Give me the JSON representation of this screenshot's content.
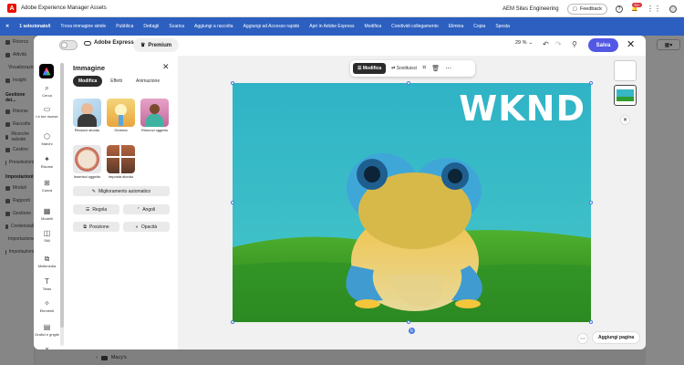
{
  "shell": {
    "app_name": "Adobe Experience Manager Assets",
    "org": "AEM Sites Engineering",
    "feedback": "Feedback",
    "notifications": "99+",
    "actions": [
      "1 selezionato/i",
      "Trova immagine simile",
      "Pubblica",
      "Dettagli",
      "Scarica",
      "Aggiungi a raccolta",
      "Aggiungi ad Accesso rapido",
      "Apri in Adobe Express",
      "Modifica",
      "Condividi collegamento",
      "Elimina",
      "Copia",
      "Sposta"
    ],
    "nav_items": [
      "Ricerca",
      "Attività",
      "Visualizzazioni",
      "Insight"
    ],
    "nav_group_1": "Gestione dei...",
    "nav_items_2": [
      "Risorse",
      "Raccolte",
      "Ricerche salvate",
      "Cestino",
      "Preselezioni"
    ],
    "nav_group_2": "Impostazioni",
    "nav_items_3": [
      "Moduli",
      "Rapporti",
      "Gestione",
      "Credenziali",
      "Importazione",
      "Importazioni"
    ],
    "bottom_folder": "Macy's",
    "view_switch": "▦"
  },
  "express": {
    "brand": "Adobe Express",
    "premium": "Premium",
    "zoom": "29 %",
    "save": "Salva",
    "rail": [
      {
        "icon": "⌕",
        "label": "Cerca"
      },
      {
        "icon": "▭",
        "label": "Le tue risorse"
      },
      {
        "icon": "⬡",
        "label": "Marchi"
      },
      {
        "icon": "✦",
        "label": "Risorse"
      },
      {
        "icon": "⊞",
        "label": "Canva"
      },
      {
        "icon": "▦",
        "label": "Modelli"
      },
      {
        "icon": "◫",
        "label": "Stili"
      },
      {
        "icon": "⧉",
        "label": "Multimedia"
      },
      {
        "icon": "T",
        "label": "Testo"
      },
      {
        "icon": "✧",
        "label": "Elementi"
      },
      {
        "icon": "▤",
        "label": "Grafici e griglie"
      },
      {
        "icon": "⌄",
        "label": ""
      }
    ],
    "panel": {
      "title": "Immagine",
      "tabs": [
        "Modifica",
        "Effetti",
        "Animazione"
      ],
      "tiles": [
        "Rimuovi sfondo",
        "Gemma",
        "Rimuovi oggetto",
        "Inserisci oggetto",
        "Imposta sfondo"
      ],
      "auto_enhance": "Miglioramento automatico",
      "buttons": [
        "Regola",
        "Angoli",
        "Posizione",
        "Opacità"
      ]
    },
    "floating_toolbar": {
      "edit": "Modifica",
      "replace": "Sostituisci"
    },
    "canvas_text": "WKND",
    "add_page": "Aggiungi pagina"
  }
}
